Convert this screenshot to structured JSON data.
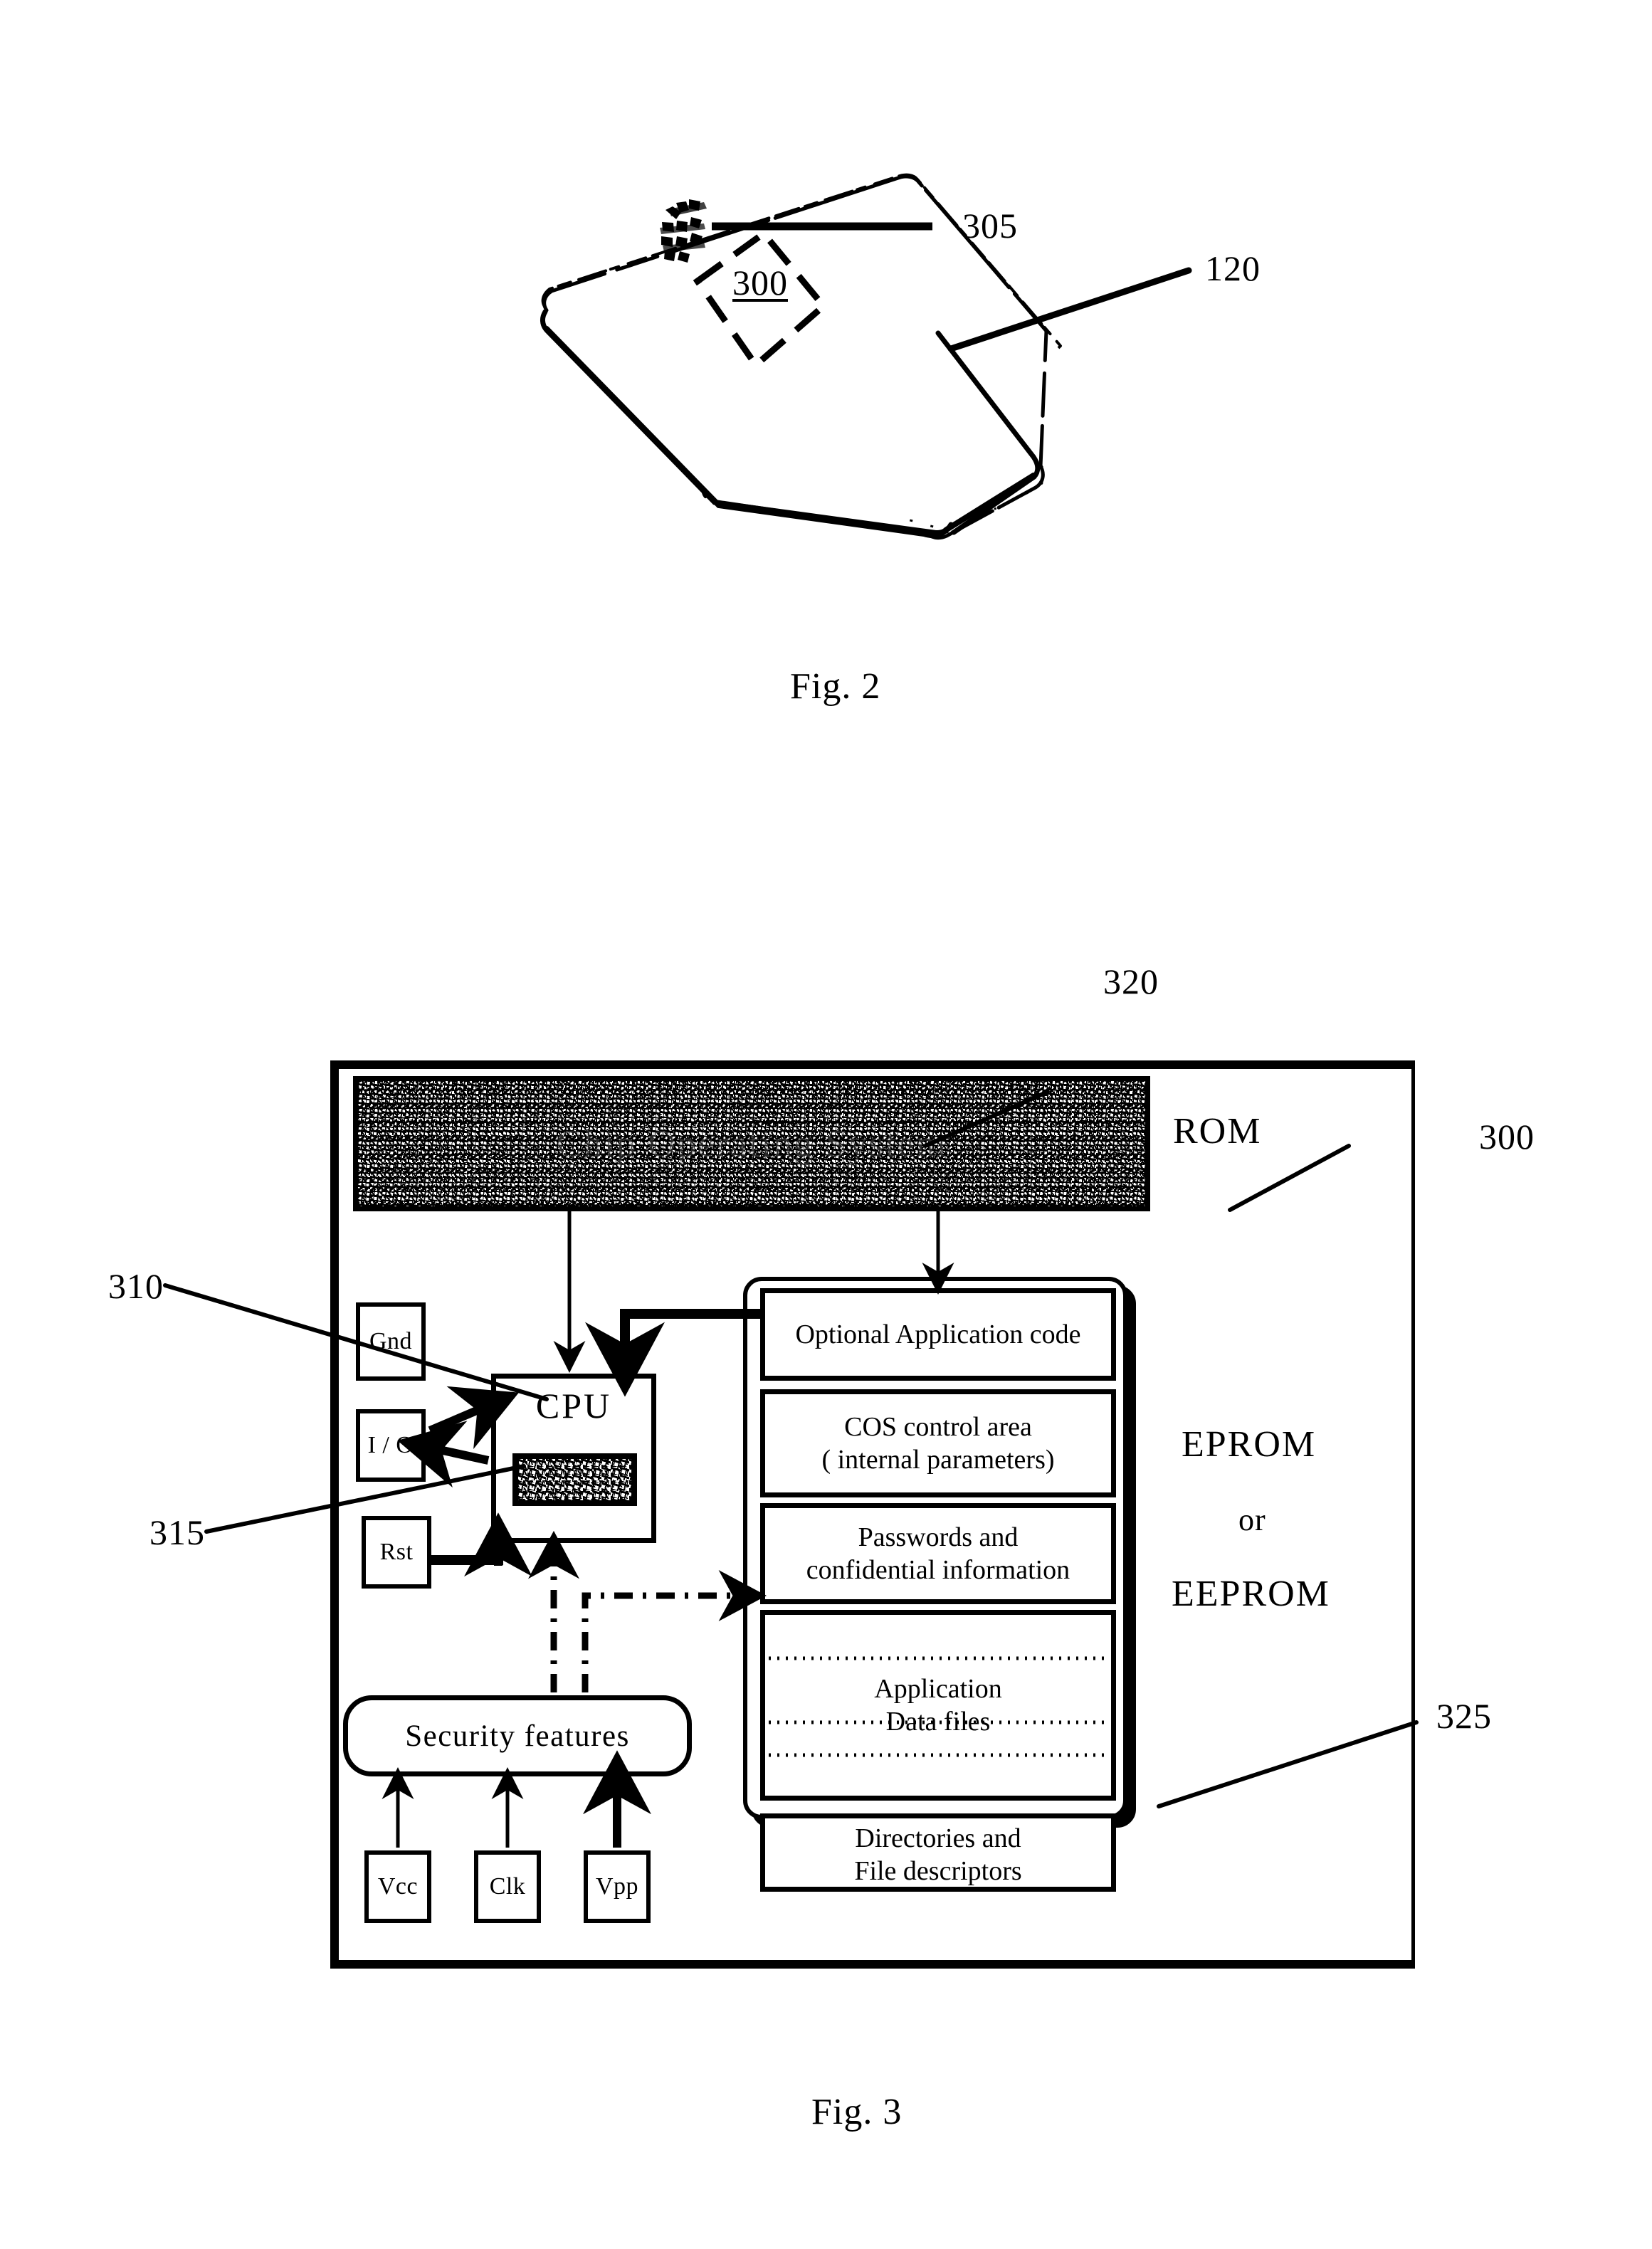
{
  "figures": [
    {
      "id": "fig2",
      "caption": "Fig. 2"
    },
    {
      "id": "fig3",
      "caption": "Fig. 3"
    }
  ],
  "fig2": {
    "caption": "Fig. 2",
    "reference_numerals": [
      {
        "id": "ref-305",
        "label": "305",
        "underlined": false,
        "points_to": "contact-pad"
      },
      {
        "id": "ref-300",
        "label": "300",
        "underlined": true,
        "points_to": "chip-module-outline"
      },
      {
        "id": "ref-120",
        "label": "120",
        "underlined": false,
        "points_to": "smart-card-body"
      }
    ],
    "elements": {
      "card_name": "smart-card-body",
      "contact_pad_name": "contact-pad",
      "chip_outline_name": "chip-module-outline"
    }
  },
  "fig3": {
    "caption": "Fig. 3",
    "reference_numerals": [
      {
        "id": "ref-320",
        "label": "320",
        "points_to": "rom-chip-operating-system"
      },
      {
        "id": "ref-300",
        "label": "300",
        "points_to": "chip-outer-frame"
      },
      {
        "id": "ref-310",
        "label": "310",
        "points_to": "cpu-block"
      },
      {
        "id": "ref-315",
        "label": "315",
        "points_to": "cpu-ram-block"
      },
      {
        "id": "ref-325",
        "label": "325",
        "points_to": "memory-frame"
      }
    ],
    "rom": {
      "banner_label": "Chip Operating System",
      "side_label": "ROM"
    },
    "eprom": {
      "side_label_line1": "EPROM",
      "side_label_line2": "or",
      "side_label_line3": "EEPROM",
      "cells": [
        {
          "id": "optional-application-code",
          "lines": [
            "Optional Application code"
          ]
        },
        {
          "id": "cos-control-area",
          "lines": [
            "COS control area",
            "( internal parameters)"
          ]
        },
        {
          "id": "passwords-confidential",
          "lines": [
            "Passwords and",
            "confidential information"
          ]
        },
        {
          "id": "application-data-files",
          "lines": [
            "Application",
            "Data files"
          ]
        },
        {
          "id": "directories-file-descriptors",
          "lines": [
            "Directories and",
            "File descriptors"
          ]
        }
      ]
    },
    "cpu": {
      "label": "CPU",
      "inner_block_name": "cpu-ram-block"
    },
    "pins": [
      {
        "id": "pin-gnd",
        "label": "Gnd"
      },
      {
        "id": "pin-io",
        "label": "I / O"
      },
      {
        "id": "pin-rst",
        "label": "Rst"
      },
      {
        "id": "pin-vcc",
        "label": "Vcc"
      },
      {
        "id": "pin-clk",
        "label": "Clk"
      },
      {
        "id": "pin-vpp",
        "label": "Vpp"
      }
    ],
    "security": {
      "label": "Security features"
    }
  },
  "colors": {
    "ink": "#000000",
    "paper": "#ffffff"
  }
}
